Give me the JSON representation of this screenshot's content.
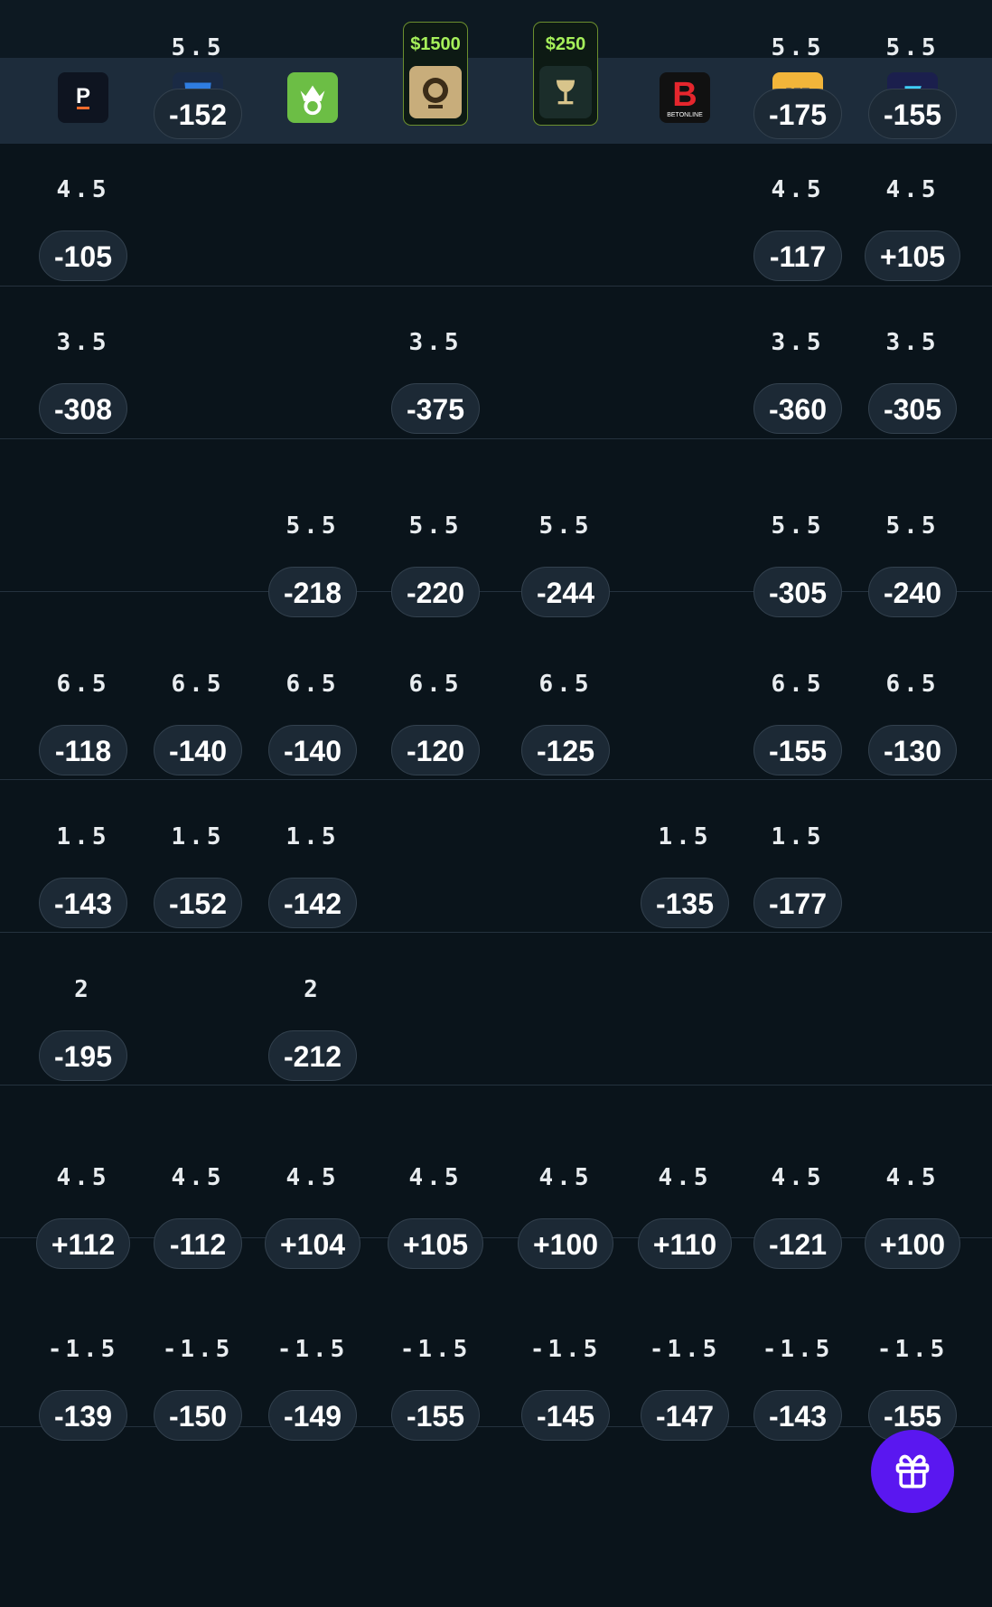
{
  "books": [
    {
      "name": "prizepicks-logo-icon",
      "letter": "P",
      "bg": "#0e1420",
      "fg": "#ffffff"
    },
    {
      "name": "fanduel-logo-icon",
      "letter": "",
      "bg": "#1a2a44",
      "fg": "#2f7de1"
    },
    {
      "name": "draftkings-logo-icon",
      "letter": "",
      "bg": "#6cbe45",
      "fg": "#ffffff"
    },
    {
      "name": "betmgm-logo-icon",
      "letter": "",
      "bg": "#c8ad7b",
      "fg": "#2a2a2a",
      "promo": "$1500"
    },
    {
      "name": "caesars-logo-icon",
      "letter": "",
      "bg": "#1b2d2a",
      "fg": "#d8c48b",
      "promo": "$250"
    },
    {
      "name": "betonline-logo-icon",
      "letter": "B",
      "bg": "#111111",
      "fg": "#e5262d"
    },
    {
      "name": "betrivers-logo-icon",
      "letter": "",
      "bg": "#f2b53a",
      "fg": "#1c2f5a"
    },
    {
      "name": "fliff-logo-icon",
      "letter": "",
      "bg": "#1b1f4d",
      "fg": "#3fd0ff"
    }
  ],
  "rows": [
    {
      "cells": [
        null,
        {
          "line": "5.5",
          "odds": "-152"
        },
        null,
        null,
        null,
        null,
        {
          "line": "5.5",
          "odds": "-175"
        },
        {
          "line": "5.5",
          "odds": "-155"
        }
      ]
    },
    {
      "cells": [
        {
          "line": "4.5",
          "odds": "-105"
        },
        null,
        null,
        null,
        null,
        null,
        {
          "line": "4.5",
          "odds": "-117"
        },
        {
          "line": "4.5",
          "odds": "+105"
        }
      ]
    },
    {
      "cells": [
        {
          "line": "3.5",
          "odds": "-308"
        },
        null,
        null,
        {
          "line": "3.5",
          "odds": "-375"
        },
        null,
        null,
        {
          "line": "3.5",
          "odds": "-360"
        },
        {
          "line": "3.5",
          "odds": "-305"
        }
      ]
    },
    {
      "cells": [
        null,
        null,
        {
          "line": "5.5",
          "odds": "-218"
        },
        {
          "line": "5.5",
          "odds": "-220"
        },
        {
          "line": "5.5",
          "odds": "-244"
        },
        null,
        {
          "line": "5.5",
          "odds": "-305"
        },
        {
          "line": "5.5",
          "odds": "-240"
        }
      ]
    },
    {
      "cells": [
        {
          "line": "6.5",
          "odds": "-118"
        },
        {
          "line": "6.5",
          "odds": "-140"
        },
        {
          "line": "6.5",
          "odds": "-140"
        },
        {
          "line": "6.5",
          "odds": "-120"
        },
        {
          "line": "6.5",
          "odds": "-125"
        },
        null,
        {
          "line": "6.5",
          "odds": "-155"
        },
        {
          "line": "6.5",
          "odds": "-130"
        }
      ]
    },
    {
      "cells": [
        {
          "line": "1.5",
          "odds": "-143"
        },
        {
          "line": "1.5",
          "odds": "-152"
        },
        {
          "line": "1.5",
          "odds": "-142"
        },
        null,
        null,
        {
          "line": "1.5",
          "odds": "-135"
        },
        {
          "line": "1.5",
          "odds": "-177"
        },
        null
      ]
    },
    {
      "cells": [
        {
          "line": "2",
          "odds": "-195"
        },
        null,
        {
          "line": "2",
          "odds": "-212"
        },
        null,
        null,
        null,
        null,
        null
      ]
    },
    {
      "cells": [
        {
          "line": "4.5",
          "odds": "+112"
        },
        {
          "line": "4.5",
          "odds": "-112"
        },
        {
          "line": "4.5",
          "odds": "+104"
        },
        {
          "line": "4.5",
          "odds": "+105"
        },
        {
          "line": "4.5",
          "odds": "+100"
        },
        {
          "line": "4.5",
          "odds": "+110"
        },
        {
          "line": "4.5",
          "odds": "-121"
        },
        {
          "line": "4.5",
          "odds": "+100"
        }
      ]
    },
    {
      "cells": [
        {
          "line": "-1.5",
          "odds": "-139"
        },
        {
          "line": "-1.5",
          "odds": "-150"
        },
        {
          "line": "-1.5",
          "odds": "-149"
        },
        {
          "line": "-1.5",
          "odds": "-155"
        },
        {
          "line": "-1.5",
          "odds": "-145"
        },
        {
          "line": "-1.5",
          "odds": "-147"
        },
        {
          "line": "-1.5",
          "odds": "-143"
        },
        {
          "line": "-1.5",
          "odds": "-155"
        }
      ]
    }
  ],
  "gift_icon": "gift-icon"
}
